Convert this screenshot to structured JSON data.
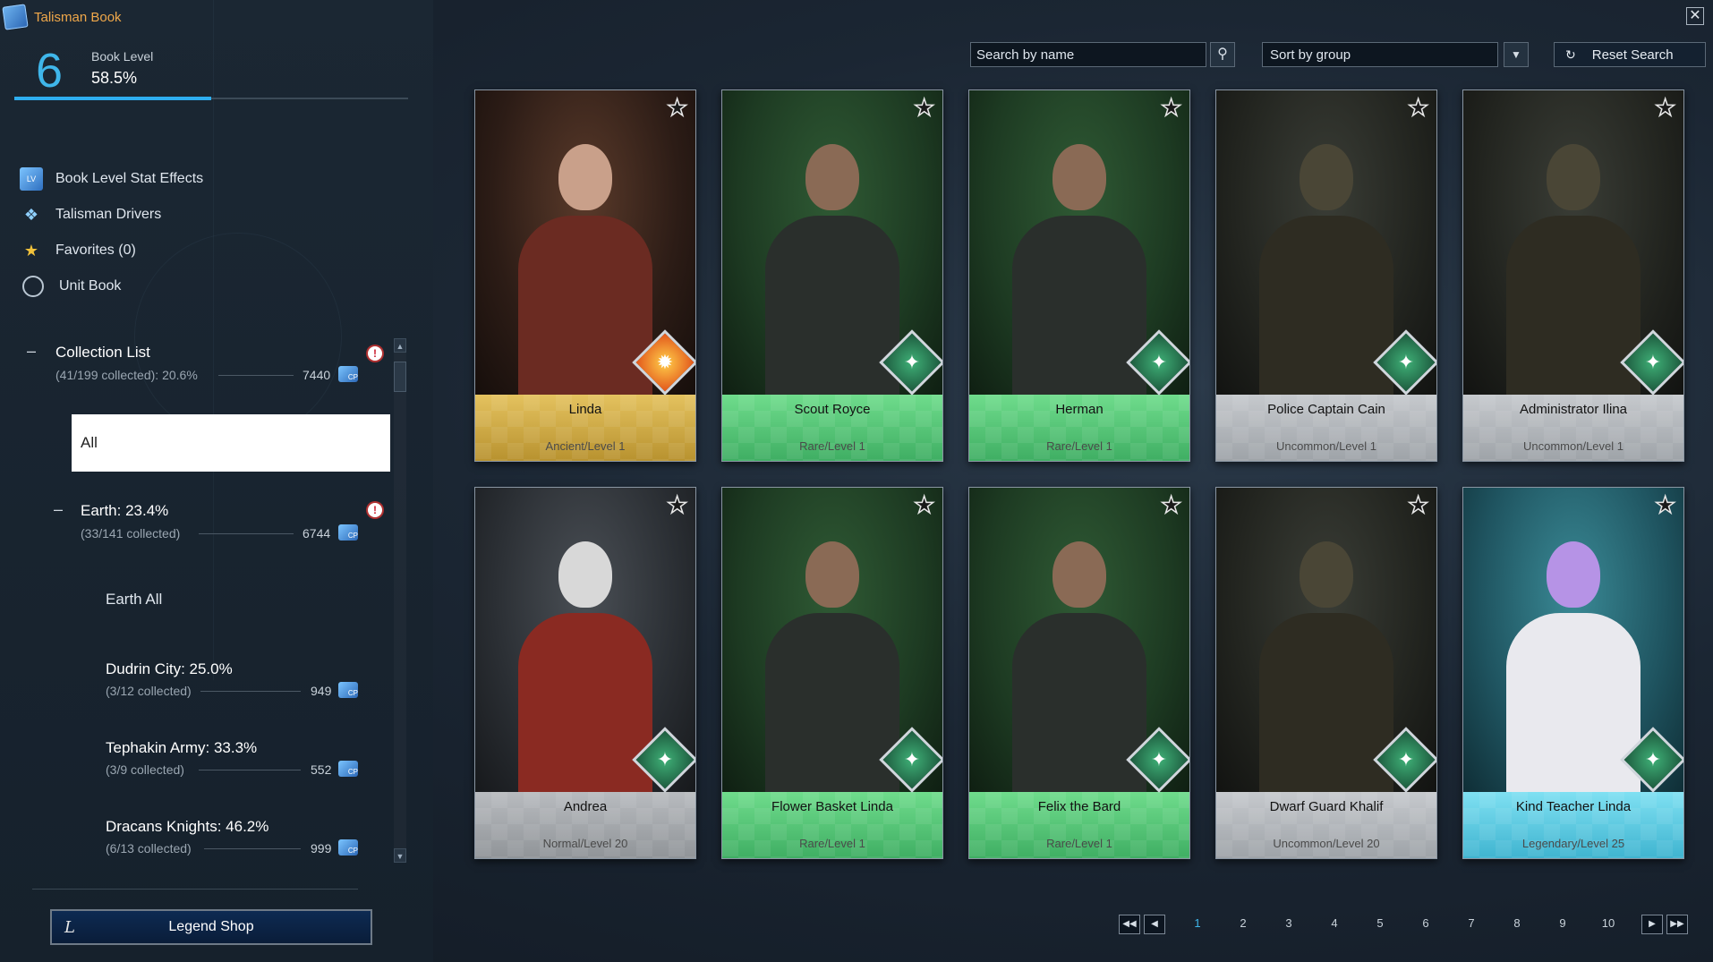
{
  "app": {
    "title": "Talisman Book"
  },
  "book_level": {
    "number": "6",
    "label": "Book Level",
    "percent": "58.5%",
    "progress": 0.5
  },
  "menu": [
    {
      "label": "Book Level Stat Effects",
      "icon": "book-level-icon"
    },
    {
      "label": "Talisman Drivers",
      "icon": "diamond-icon"
    },
    {
      "label": "Favorites (0)",
      "icon": "star-icon"
    },
    {
      "label": "Unit Book",
      "icon": "unit-book-icon"
    }
  ],
  "collection": {
    "collapse_glyph": "–",
    "title": "Collection List",
    "summary": "(41/199 collected): 20.6%",
    "cp": "7440",
    "all_label": "All"
  },
  "earth": {
    "collapse_glyph": "–",
    "title": "Earth: 23.4%",
    "summary": "(33/141 collected)",
    "cp": "6744",
    "all_label": "Earth All"
  },
  "groups": [
    {
      "title": "Dudrin City: 25.0%",
      "summary": "(3/12 collected)",
      "cp": "949"
    },
    {
      "title": "Tephakin Army: 33.3%",
      "summary": "(3/9 collected)",
      "cp": "552"
    },
    {
      "title": "Dracans Knights: 46.2%",
      "summary": "(6/13 collected)",
      "cp": "999"
    }
  ],
  "cp_icon_label": "CP",
  "legend_shop": {
    "label": "Legend Shop",
    "glyph": "L"
  },
  "search": {
    "placeholder": "Search by name",
    "value": ""
  },
  "sort": {
    "selected": "Sort by group"
  },
  "reset": {
    "label": "Reset Search"
  },
  "close_glyph": "✕",
  "colors": {
    "accent": "#2eaef0",
    "ancient": "#d9b24a",
    "rare": "#5fcf7e",
    "uncommon": "#b4b8bd",
    "normal": "#a9adb2",
    "legendary": "#5fd0e8"
  },
  "cards": [
    {
      "name": "Linda",
      "rank": "Ancient/Level 1",
      "tier": "ancient",
      "emblem": "fire-emblem-icon"
    },
    {
      "name": "Scout Royce",
      "rank": "Rare/Level 1",
      "tier": "rare",
      "emblem": "earth-emblem-icon"
    },
    {
      "name": "Herman",
      "rank": "Rare/Level 1",
      "tier": "rare",
      "emblem": "earth-emblem-icon"
    },
    {
      "name": "Police Captain Cain",
      "rank": "Uncommon/Level 1",
      "tier": "uncommon",
      "emblem": "earth-emblem-icon"
    },
    {
      "name": "Administrator Ilina",
      "rank": "Uncommon/Level 1",
      "tier": "uncommon",
      "emblem": "earth-emblem-icon"
    },
    {
      "name": "Andrea",
      "rank": "Normal/Level 20",
      "tier": "normal",
      "emblem": "earth-emblem-icon"
    },
    {
      "name": "Flower Basket Linda",
      "rank": "Rare/Level 1",
      "tier": "rare",
      "emblem": "earth-emblem-icon"
    },
    {
      "name": "Felix the Bard",
      "rank": "Rare/Level 1",
      "tier": "rare",
      "emblem": "earth-emblem-icon"
    },
    {
      "name": "Dwarf Guard Khalif",
      "rank": "Uncommon/Level 20",
      "tier": "uncommon",
      "emblem": "earth-emblem-icon"
    },
    {
      "name": "Kind Teacher Linda",
      "rank": "Legendary/Level 25",
      "tier": "legendary",
      "emblem": "earth-emblem-icon"
    }
  ],
  "pagination": {
    "pages": [
      "1",
      "2",
      "3",
      "4",
      "5",
      "6",
      "7",
      "8",
      "9",
      "10"
    ],
    "current": "1"
  }
}
